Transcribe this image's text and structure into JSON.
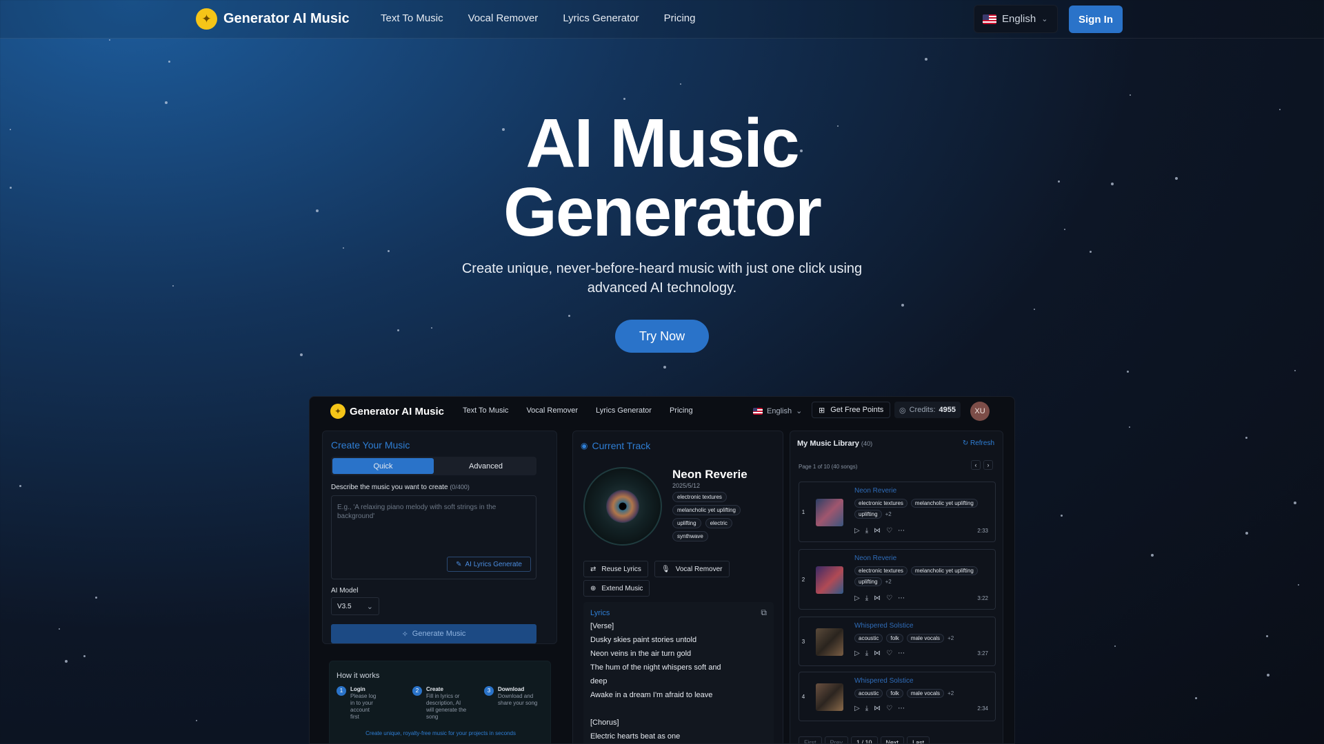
{
  "nav": {
    "logo_text": "Generator AI Music",
    "links": [
      "Text To Music",
      "Vocal Remover",
      "Lyrics Generator",
      "Pricing"
    ],
    "language": "English",
    "sign_in": "Sign In"
  },
  "hero": {
    "title_line1": "AI Music",
    "title_line2": "Generator",
    "subtitle": "Create unique, never-before-heard music with just one click using advanced AI technology.",
    "cta": "Try Now"
  },
  "app": {
    "logo_text": "Generator AI Music",
    "links": [
      "Text To Music",
      "Vocal Remover",
      "Lyrics Generator",
      "Pricing"
    ],
    "language": "English",
    "free_points": "Get Free Points",
    "credits_label": "Credits:",
    "credits_value": "4955",
    "avatar": "XU",
    "create": {
      "title": "Create Your Music",
      "tab_quick": "Quick",
      "tab_advanced": "Advanced",
      "describe_label": "Describe the music you want to create",
      "describe_count": "(0/400)",
      "placeholder": "E.g., 'A relaxing piano melody with soft strings in the background'",
      "ai_lyrics": "AI Lyrics Generate",
      "model_label": "AI Model",
      "model_value": "V3.5",
      "generate": "Generate Music"
    },
    "how": {
      "title": "How it works",
      "steps": [
        {
          "n": "1",
          "title": "Login",
          "desc": "Please log in to your account first"
        },
        {
          "n": "2",
          "title": "Create",
          "desc": "Fill in lyrics or description, AI will generate the song"
        },
        {
          "n": "3",
          "title": "Download",
          "desc": "Download and share your song"
        }
      ],
      "footer": "Create unique, royalty-free music for your projects in seconds"
    },
    "current": {
      "title": "Current Track",
      "name": "Neon Reverie",
      "date": "2025/5/12",
      "tags": [
        "electronic textures",
        "melancholic yet uplifting",
        "uplifting",
        "electric",
        "synthwave"
      ],
      "reuse_lyrics": "Reuse Lyrics",
      "vocal_remover": "Vocal Remover",
      "extend_music": "Extend Music",
      "lyrics_title": "Lyrics",
      "lyrics": [
        "[Verse]",
        "Dusky skies paint stories untold",
        "Neon veins in the air turn gold",
        "The hum of the night whispers soft and",
        "deep",
        "Awake in a dream I'm afraid to leave",
        "",
        "[Chorus]",
        "Electric hearts beat as one"
      ]
    },
    "library": {
      "title": "My Music Library",
      "count": "(40)",
      "refresh": "Refresh",
      "page_info": "Page 1 of 10 (40 songs)",
      "songs": [
        {
          "idx": "1",
          "name": "Neon Reverie",
          "tags": [
            "electronic textures",
            "melancholic yet uplifting",
            "uplifting"
          ],
          "more": "+2",
          "dur": "2:33"
        },
        {
          "idx": "2",
          "name": "Neon Reverie",
          "tags": [
            "electronic textures",
            "melancholic yet uplifting",
            "uplifting"
          ],
          "more": "+2",
          "dur": "3:22"
        },
        {
          "idx": "3",
          "name": "Whispered Solstice",
          "tags": [
            "acoustic",
            "folk",
            "male vocals"
          ],
          "more": "+2",
          "dur": "3:27"
        },
        {
          "idx": "4",
          "name": "Whispered Solstice",
          "tags": [
            "acoustic",
            "folk",
            "male vocals"
          ],
          "more": "+2",
          "dur": "2:34"
        }
      ],
      "pager": {
        "first": "First",
        "prev": "Prev",
        "page": "1 / 10",
        "next": "Next",
        "last": "Last"
      }
    }
  }
}
